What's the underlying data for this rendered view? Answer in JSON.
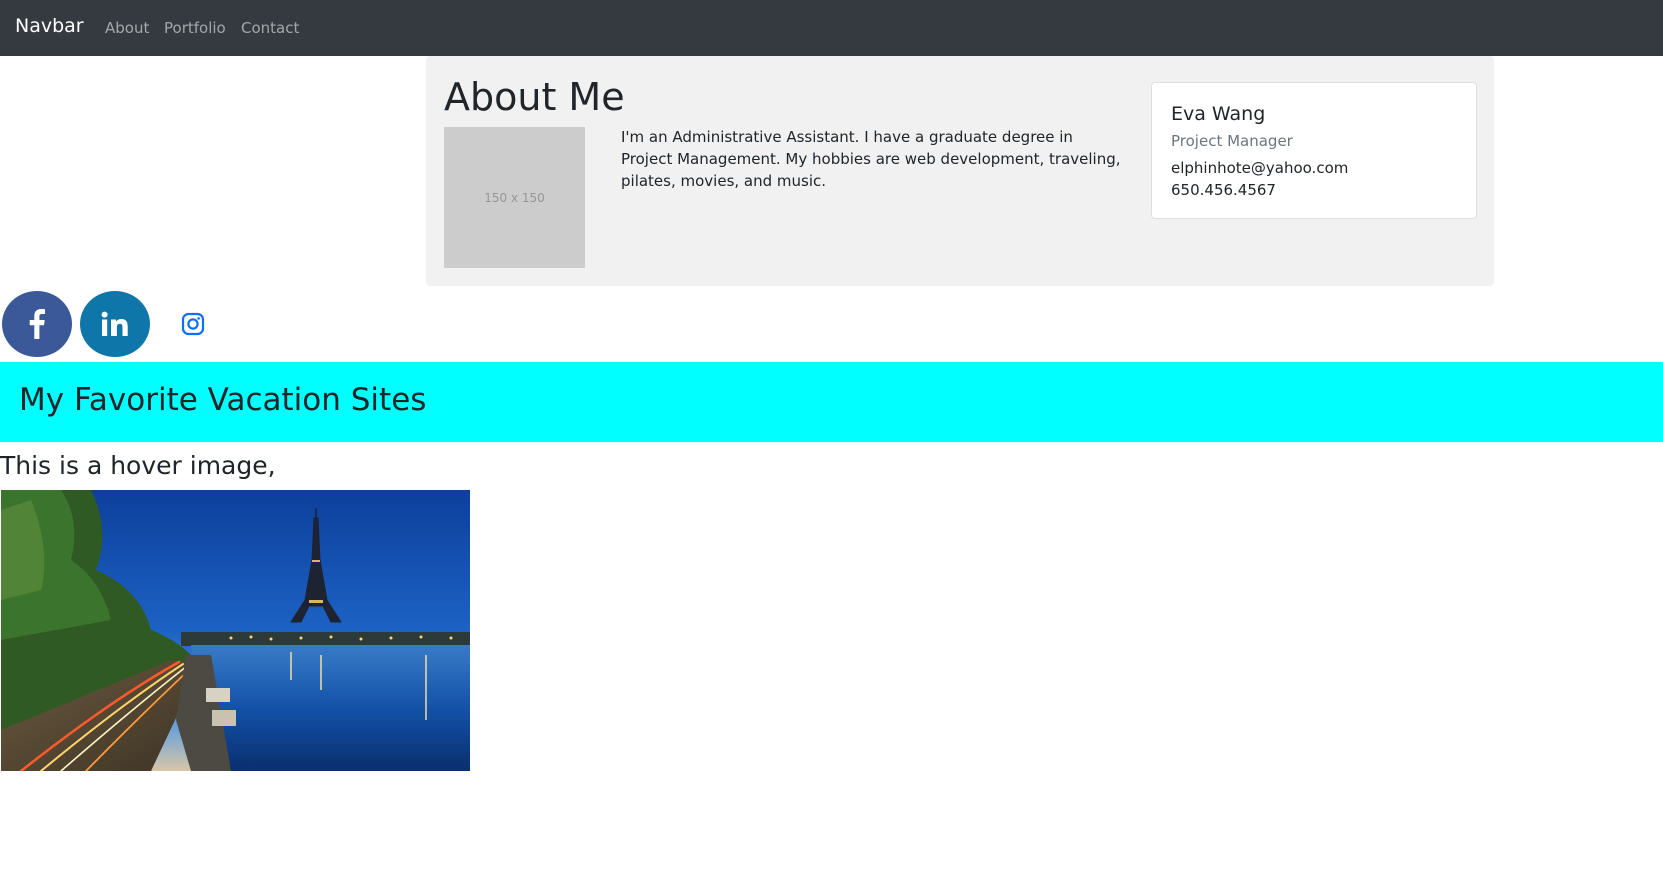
{
  "navbar": {
    "brand": "Navbar",
    "links": [
      "About",
      "Portfolio",
      "Contact"
    ]
  },
  "about": {
    "title": "About Me",
    "placeholder_label": "150 x 150",
    "bio": "I'm an Administrative Assistant. I have a graduate degree in Project Management. My hobbies are web development, traveling, pilates, movies, and music."
  },
  "card": {
    "name": "Eva Wang",
    "role": "Project Manager",
    "email": "elphinhote@yahoo.com",
    "phone": "650.456.4567"
  },
  "social": {
    "icons": [
      "facebook-icon",
      "linkedin-icon",
      "instagram-icon"
    ],
    "colors": {
      "facebook": "#3b5998",
      "linkedin": "#0e76a8",
      "instagram": "#0d6efd"
    }
  },
  "banner": {
    "title": "My Favorite Vacation Sites",
    "color": "#00ffff"
  },
  "hover": {
    "caption": "This is a hover image,"
  },
  "colors": {
    "navbar_bg": "#343a40",
    "about_bg": "#f1f1f1"
  }
}
